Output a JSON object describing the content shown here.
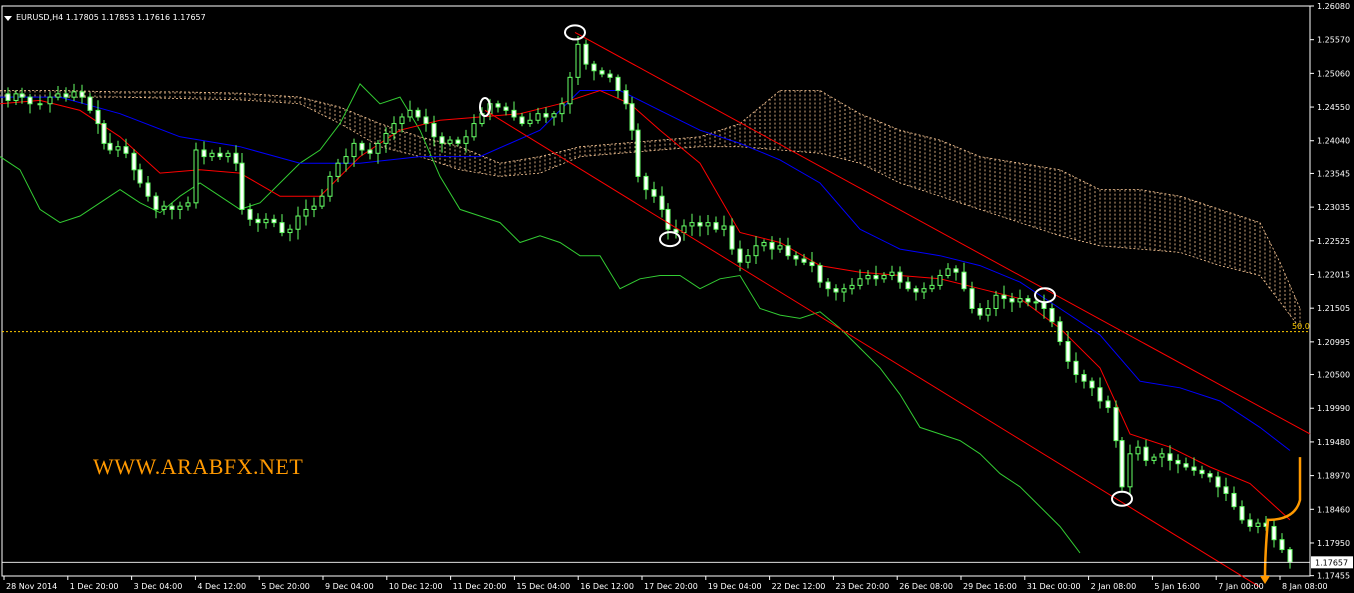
{
  "header": {
    "symbol_info": "EURUSD,H4  1.17805 1.17853 1.17616 1.17657"
  },
  "watermark": "WWW.ARABFX.NET",
  "fibo_label": "50.0",
  "colors": {
    "background": "#000000",
    "bull_candle": "#ffffff",
    "bear_candle": "#ffffff",
    "candle_wick": "#66ff66",
    "tenkan": "#ff0000",
    "kijun": "#0000ff",
    "chikou": "#33cc33",
    "cloud": "#ffcc99",
    "channel": "#ff0000",
    "fibo": "#ffcc00",
    "annotation_arrow": "#ff9900",
    "marker": "#ffffff"
  },
  "chart_data": {
    "type": "candlestick",
    "ylim": [
      1.1745,
      1.2608
    ],
    "y_ticks": [
      "1.26080",
      "1.25570",
      "1.25060",
      "1.24550",
      "1.24040",
      "1.23545",
      "1.23035",
      "1.22525",
      "1.22015",
      "1.21505",
      "1.20995",
      "1.20500",
      "1.19990",
      "1.19480",
      "1.18970",
      "1.18460",
      "1.17950",
      "1.17455"
    ],
    "current_price": "1.17657",
    "x_ticks": [
      "28 Nov 2014",
      "1 Dec 20:00",
      "3 Dec 04:00",
      "4 Dec 12:00",
      "5 Dec 20:00",
      "9 Dec 04:00",
      "10 Dec 12:00",
      "11 Dec 20:00",
      "15 Dec 04:00",
      "16 Dec 12:00",
      "17 Dec 20:00",
      "19 Dec 04:00",
      "22 Dec 12:00",
      "23 Dec 20:00",
      "26 Dec 08:00",
      "29 Dec 16:00",
      "31 Dec 00:00",
      "2 Jan 08:00",
      "5 Jan 16:00",
      "7 Jan 00:00",
      "8 Jan 08:00"
    ],
    "fibo_level": 1.2115,
    "price_path": [
      [
        0,
        1.2475
      ],
      [
        8,
        1.2465
      ],
      [
        16,
        1.2475
      ],
      [
        22,
        1.247
      ],
      [
        30,
        1.246
      ],
      [
        40,
        1.246
      ],
      [
        50,
        1.247
      ],
      [
        58,
        1.2475
      ],
      [
        66,
        1.247
      ],
      [
        74,
        1.2478
      ],
      [
        82,
        1.247
      ],
      [
        90,
        1.245
      ],
      [
        98,
        1.243
      ],
      [
        104,
        1.24
      ],
      [
        110,
        1.239
      ],
      [
        118,
        1.2395
      ],
      [
        126,
        1.2385
      ],
      [
        134,
        1.236
      ],
      [
        140,
        1.234
      ],
      [
        148,
        1.232
      ],
      [
        156,
        1.23
      ],
      [
        164,
        1.2305
      ],
      [
        172,
        1.23
      ],
      [
        180,
        1.2305
      ],
      [
        188,
        1.231
      ],
      [
        196,
        1.239
      ],
      [
        204,
        1.238
      ],
      [
        212,
        1.2385
      ],
      [
        220,
        1.238
      ],
      [
        228,
        1.2385
      ],
      [
        236,
        1.237
      ],
      [
        242,
        1.23
      ],
      [
        250,
        1.2285
      ],
      [
        258,
        1.228
      ],
      [
        266,
        1.2285
      ],
      [
        274,
        1.228
      ],
      [
        282,
        1.2265
      ],
      [
        290,
        1.227
      ],
      [
        298,
        1.229
      ],
      [
        306,
        1.23
      ],
      [
        314,
        1.2305
      ],
      [
        322,
        1.232
      ],
      [
        330,
        1.235
      ],
      [
        338,
        1.237
      ],
      [
        346,
        1.238
      ],
      [
        354,
        1.24
      ],
      [
        362,
        1.239
      ],
      [
        370,
        1.2385
      ],
      [
        378,
        1.24
      ],
      [
        386,
        1.2415
      ],
      [
        394,
        1.243
      ],
      [
        402,
        1.244
      ],
      [
        410,
        1.245
      ],
      [
        418,
        1.244
      ],
      [
        426,
        1.243
      ],
      [
        434,
        1.241
      ],
      [
        442,
        1.24
      ],
      [
        450,
        1.2405
      ],
      [
        458,
        1.24
      ],
      [
        466,
        1.241
      ],
      [
        474,
        1.243
      ],
      [
        482,
        1.2445
      ],
      [
        490,
        1.246
      ],
      [
        498,
        1.2455
      ],
      [
        506,
        1.245
      ],
      [
        514,
        1.244
      ],
      [
        522,
        1.243
      ],
      [
        530,
        1.2435
      ],
      [
        538,
        1.2445
      ],
      [
        546,
        1.244
      ],
      [
        554,
        1.2445
      ],
      [
        562,
        1.246
      ],
      [
        570,
        1.25
      ],
      [
        578,
        1.255
      ],
      [
        586,
        1.252
      ],
      [
        594,
        1.251
      ],
      [
        602,
        1.2505
      ],
      [
        610,
        1.25
      ],
      [
        618,
        1.248
      ],
      [
        626,
        1.246
      ],
      [
        632,
        1.242
      ],
      [
        638,
        1.235
      ],
      [
        646,
        1.233
      ],
      [
        654,
        1.232
      ],
      [
        662,
        1.23
      ],
      [
        668,
        1.227
      ],
      [
        676,
        1.2265
      ],
      [
        684,
        1.2275
      ],
      [
        692,
        1.228
      ],
      [
        700,
        1.2275
      ],
      [
        708,
        1.228
      ],
      [
        716,
        1.227
      ],
      [
        724,
        1.2275
      ],
      [
        732,
        1.224
      ],
      [
        740,
        1.222
      ],
      [
        748,
        1.223
      ],
      [
        756,
        1.2245
      ],
      [
        764,
        1.225
      ],
      [
        772,
        1.224
      ],
      [
        780,
        1.2245
      ],
      [
        788,
        1.223
      ],
      [
        796,
        1.2225
      ],
      [
        804,
        1.222
      ],
      [
        812,
        1.2215
      ],
      [
        820,
        1.219
      ],
      [
        828,
        1.218
      ],
      [
        836,
        1.2175
      ],
      [
        844,
        1.218
      ],
      [
        852,
        1.2185
      ],
      [
        860,
        1.2195
      ],
      [
        868,
        1.22
      ],
      [
        876,
        1.2195
      ],
      [
        884,
        1.22
      ],
      [
        892,
        1.2205
      ],
      [
        900,
        1.219
      ],
      [
        908,
        1.218
      ],
      [
        916,
        1.2175
      ],
      [
        924,
        1.218
      ],
      [
        932,
        1.2185
      ],
      [
        940,
        1.22
      ],
      [
        948,
        1.221
      ],
      [
        956,
        1.2205
      ],
      [
        964,
        1.218
      ],
      [
        972,
        1.215
      ],
      [
        980,
        1.214
      ],
      [
        988,
        1.215
      ],
      [
        996,
        1.217
      ],
      [
        1004,
        1.2165
      ],
      [
        1012,
        1.216
      ],
      [
        1020,
        1.2165
      ],
      [
        1028,
        1.216
      ],
      [
        1036,
        1.216
      ],
      [
        1044,
        1.215
      ],
      [
        1052,
        1.213
      ],
      [
        1060,
        1.21
      ],
      [
        1068,
        1.207
      ],
      [
        1076,
        1.205
      ],
      [
        1084,
        1.204
      ],
      [
        1092,
        1.203
      ],
      [
        1100,
        1.201
      ],
      [
        1108,
        1.2
      ],
      [
        1116,
        1.195
      ],
      [
        1122,
        1.188
      ],
      [
        1130,
        1.193
      ],
      [
        1138,
        1.194
      ],
      [
        1146,
        1.192
      ],
      [
        1154,
        1.1925
      ],
      [
        1162,
        1.193
      ],
      [
        1170,
        1.192
      ],
      [
        1178,
        1.1915
      ],
      [
        1186,
        1.191
      ],
      [
        1194,
        1.1905
      ],
      [
        1202,
        1.19
      ],
      [
        1210,
        1.1895
      ],
      [
        1218,
        1.188
      ],
      [
        1226,
        1.187
      ],
      [
        1234,
        1.185
      ],
      [
        1242,
        1.183
      ],
      [
        1250,
        1.182
      ],
      [
        1258,
        1.1825
      ],
      [
        1266,
        1.182
      ],
      [
        1274,
        1.18
      ],
      [
        1282,
        1.1785
      ],
      [
        1290,
        1.1766
      ]
    ],
    "tenkan_path": [
      [
        0,
        1.246
      ],
      [
        40,
        1.2465
      ],
      [
        80,
        1.245
      ],
      [
        120,
        1.241
      ],
      [
        160,
        1.2355
      ],
      [
        200,
        1.236
      ],
      [
        240,
        1.2355
      ],
      [
        280,
        1.232
      ],
      [
        320,
        1.232
      ],
      [
        360,
        1.238
      ],
      [
        400,
        1.242
      ],
      [
        440,
        1.2435
      ],
      [
        480,
        1.244
      ],
      [
        520,
        1.2445
      ],
      [
        560,
        1.246
      ],
      [
        600,
        1.248
      ],
      [
        630,
        1.246
      ],
      [
        660,
        1.242
      ],
      [
        700,
        1.237
      ],
      [
        740,
        1.2265
      ],
      [
        780,
        1.225
      ],
      [
        820,
        1.2215
      ],
      [
        860,
        1.2205
      ],
      [
        900,
        1.22
      ],
      [
        940,
        1.2195
      ],
      [
        980,
        1.218
      ],
      [
        1020,
        1.2165
      ],
      [
        1060,
        1.212
      ],
      [
        1100,
        1.206
      ],
      [
        1130,
        1.196
      ],
      [
        1170,
        1.194
      ],
      [
        1210,
        1.191
      ],
      [
        1250,
        1.1885
      ],
      [
        1290,
        1.183
      ]
    ],
    "kijun_path": [
      [
        0,
        1.247
      ],
      [
        60,
        1.247
      ],
      [
        120,
        1.2445
      ],
      [
        180,
        1.241
      ],
      [
        240,
        1.2395
      ],
      [
        300,
        1.237
      ],
      [
        360,
        1.237
      ],
      [
        420,
        1.238
      ],
      [
        480,
        1.238
      ],
      [
        540,
        1.242
      ],
      [
        580,
        1.248
      ],
      [
        620,
        1.248
      ],
      [
        660,
        1.245
      ],
      [
        700,
        1.242
      ],
      [
        740,
        1.24
      ],
      [
        780,
        1.2375
      ],
      [
        820,
        1.234
      ],
      [
        860,
        1.227
      ],
      [
        900,
        1.224
      ],
      [
        940,
        1.223
      ],
      [
        980,
        1.2215
      ],
      [
        1020,
        1.219
      ],
      [
        1060,
        1.215
      ],
      [
        1100,
        1.211
      ],
      [
        1140,
        1.204
      ],
      [
        1180,
        1.203
      ],
      [
        1220,
        1.201
      ],
      [
        1260,
        1.197
      ],
      [
        1290,
        1.1935
      ]
    ],
    "chikou_path": [
      [
        0,
        1.238
      ],
      [
        20,
        1.236
      ],
      [
        40,
        1.23
      ],
      [
        60,
        1.228
      ],
      [
        80,
        1.229
      ],
      [
        100,
        1.231
      ],
      [
        120,
        1.233
      ],
      [
        140,
        1.231
      ],
      [
        160,
        1.2295
      ],
      [
        180,
        1.232
      ],
      [
        200,
        1.234
      ],
      [
        220,
        1.232
      ],
      [
        240,
        1.23
      ],
      [
        260,
        1.231
      ],
      [
        280,
        1.234
      ],
      [
        300,
        1.237
      ],
      [
        320,
        1.239
      ],
      [
        340,
        1.243
      ],
      [
        360,
        1.249
      ],
      [
        380,
        1.246
      ],
      [
        400,
        1.247
      ],
      [
        420,
        1.242
      ],
      [
        440,
        1.235
      ],
      [
        460,
        1.23
      ],
      [
        480,
        1.229
      ],
      [
        500,
        1.228
      ],
      [
        520,
        1.225
      ],
      [
        540,
        1.226
      ],
      [
        560,
        1.225
      ],
      [
        580,
        1.223
      ],
      [
        600,
        1.223
      ],
      [
        620,
        1.218
      ],
      [
        640,
        1.2195
      ],
      [
        660,
        1.22
      ],
      [
        680,
        1.22
      ],
      [
        700,
        1.218
      ],
      [
        720,
        1.2195
      ],
      [
        740,
        1.22
      ],
      [
        760,
        1.215
      ],
      [
        780,
        1.214
      ],
      [
        800,
        1.2135
      ],
      [
        820,
        1.2145
      ],
      [
        840,
        1.212
      ],
      [
        860,
        1.209
      ],
      [
        880,
        1.206
      ],
      [
        900,
        1.202
      ],
      [
        920,
        1.197
      ],
      [
        940,
        1.196
      ],
      [
        960,
        1.195
      ],
      [
        980,
        1.193
      ],
      [
        1000,
        1.19
      ],
      [
        1020,
        1.188
      ],
      [
        1040,
        1.185
      ],
      [
        1060,
        1.182
      ],
      [
        1080,
        1.178
      ]
    ],
    "cloud_upper_path": [
      [
        0,
        1.248
      ],
      [
        60,
        1.248
      ],
      [
        120,
        1.2478
      ],
      [
        180,
        1.2478
      ],
      [
        240,
        1.2476
      ],
      [
        300,
        1.247
      ],
      [
        340,
        1.2455
      ],
      [
        380,
        1.243
      ],
      [
        420,
        1.241
      ],
      [
        460,
        1.2395
      ],
      [
        500,
        1.237
      ],
      [
        540,
        1.238
      ],
      [
        580,
        1.2395
      ],
      [
        620,
        1.24
      ],
      [
        660,
        1.2405
      ],
      [
        700,
        1.241
      ],
      [
        740,
        1.243
      ],
      [
        780,
        1.248
      ],
      [
        820,
        1.248
      ],
      [
        860,
        1.2445
      ],
      [
        900,
        1.242
      ],
      [
        940,
        1.2405
      ],
      [
        980,
        1.238
      ],
      [
        1020,
        1.237
      ],
      [
        1060,
        1.236
      ],
      [
        1100,
        1.233
      ],
      [
        1140,
        1.233
      ],
      [
        1180,
        1.232
      ],
      [
        1220,
        1.23
      ],
      [
        1260,
        1.228
      ],
      [
        1280,
        1.222
      ],
      [
        1300,
        1.215
      ]
    ],
    "cloud_lower_path": [
      [
        0,
        1.247
      ],
      [
        60,
        1.247
      ],
      [
        120,
        1.247
      ],
      [
        180,
        1.2468
      ],
      [
        240,
        1.2466
      ],
      [
        300,
        1.246
      ],
      [
        340,
        1.243
      ],
      [
        380,
        1.2395
      ],
      [
        420,
        1.238
      ],
      [
        460,
        1.236
      ],
      [
        500,
        1.235
      ],
      [
        540,
        1.2355
      ],
      [
        580,
        1.238
      ],
      [
        620,
        1.2385
      ],
      [
        660,
        1.239
      ],
      [
        700,
        1.2395
      ],
      [
        740,
        1.2395
      ],
      [
        780,
        1.239
      ],
      [
        820,
        1.2385
      ],
      [
        860,
        1.237
      ],
      [
        900,
        1.234
      ],
      [
        940,
        1.232
      ],
      [
        980,
        1.23
      ],
      [
        1020,
        1.228
      ],
      [
        1060,
        1.226
      ],
      [
        1100,
        1.2245
      ],
      [
        1140,
        1.224
      ],
      [
        1180,
        1.2235
      ],
      [
        1220,
        1.2215
      ],
      [
        1260,
        1.22
      ],
      [
        1280,
        1.216
      ],
      [
        1300,
        1.212
      ]
    ],
    "channel_upper": [
      [
        575,
        1.2568
      ],
      [
        1310,
        1.196
      ]
    ],
    "channel_lower": [
      [
        485,
        1.245
      ],
      [
        1260,
        1.1728
      ]
    ],
    "markers": [
      [
        575,
        1.2568
      ],
      [
        485,
        1.2455
      ],
      [
        670,
        1.2255
      ],
      [
        1045,
        1.217
      ],
      [
        1122,
        1.1862
      ]
    ],
    "arrow_path": [
      [
        1300,
        1.1925
      ],
      [
        1300,
        1.186
      ],
      [
        1295,
        1.183
      ],
      [
        1268,
        1.183
      ],
      [
        1265,
        1.178
      ],
      [
        1265,
        1.1745
      ]
    ]
  }
}
